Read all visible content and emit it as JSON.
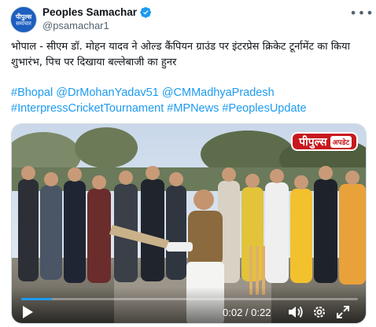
{
  "account": {
    "avatar_line1": "पीपुल्स",
    "avatar_line2": "समाचार",
    "display_name": "Peoples Samachar",
    "handle": "@psamachar1"
  },
  "tweet": {
    "text": "भोपाल - सीएम डॉ. मोहन यादव ने ओल्ड कैंपियन ग्राउंड पर इंटरप्रेस क्रिकेट टूर्नामेंट का किया शुभारंभ, पिच पर दिखाया बल्लेबाजी का हुनर",
    "hashtags_line1": [
      "#Bhopal",
      "@DrMohanYadav51",
      "@CMMadhyaPradesh"
    ],
    "hashtags_line2": [
      "#InterpressCricketTournament",
      "#MPNews",
      "#PeoplesUpdate"
    ]
  },
  "video": {
    "brand_main": "पीपुल्स",
    "brand_tag": "अपडेट",
    "time_display": "0:02 / 0:22",
    "progress_fraction": 0.09
  },
  "icons": {
    "more": "more-icon",
    "verified": "verified-badge-icon",
    "play": "play-icon",
    "volume": "volume-icon",
    "settings": "settings-icon",
    "fullscreen": "fullscreen-icon"
  },
  "colors": {
    "link": "#1d9bf0",
    "verified": "#1d9bf0",
    "brand_red": "#c8181e"
  }
}
